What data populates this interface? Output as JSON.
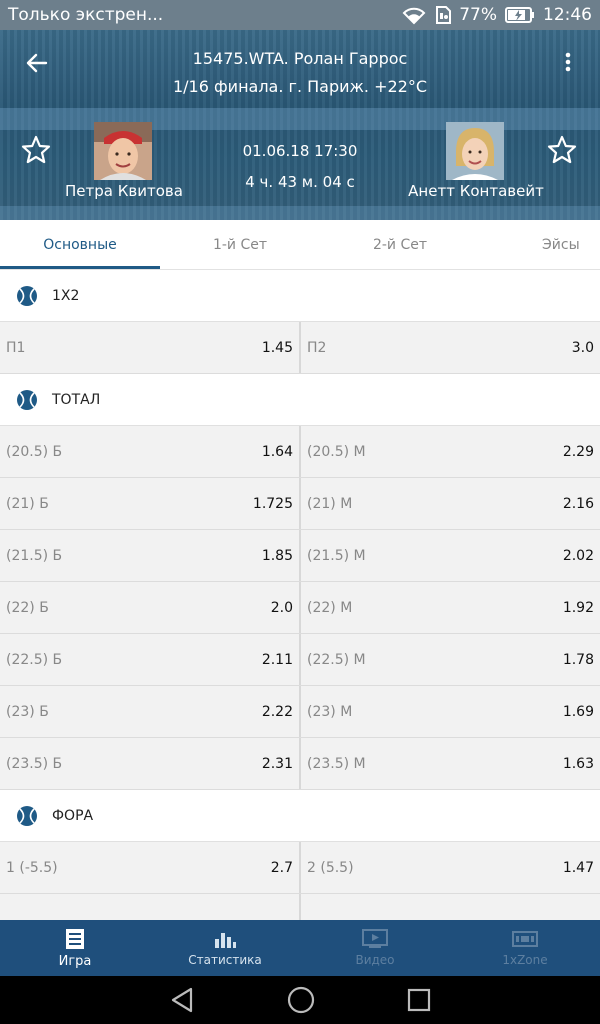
{
  "status_bar": {
    "notification": "Только экстрен...",
    "battery": "77%",
    "time": "12:46"
  },
  "header": {
    "title": "15475.WTA. Ролан Гаррос",
    "subtitle": "1/16 финала. г. Париж. +22°C",
    "date": "01.06.18 17:30",
    "duration": "4 ч. 43 м. 04 с",
    "player1": "Петра Квитова",
    "player2": "Анетт Контавейт"
  },
  "tabs": [
    {
      "label": "Основные",
      "active": true
    },
    {
      "label": "1-й Сет"
    },
    {
      "label": "2-й Сет"
    },
    {
      "label": "Эйсы"
    }
  ],
  "sections": [
    {
      "title": "1X2",
      "rows": [
        {
          "l_label": "П1",
          "l_val": "1.45",
          "r_label": "П2",
          "r_val": "3.0"
        }
      ]
    },
    {
      "title": "ТОТАЛ",
      "rows": [
        {
          "l_label": "(20.5) Б",
          "l_val": "1.64",
          "r_label": "(20.5) М",
          "r_val": "2.29"
        },
        {
          "l_label": "(21) Б",
          "l_val": "1.725",
          "r_label": "(21) М",
          "r_val": "2.16"
        },
        {
          "l_label": "(21.5) Б",
          "l_val": "1.85",
          "r_label": "(21.5) М",
          "r_val": "2.02"
        },
        {
          "l_label": "(22) Б",
          "l_val": "2.0",
          "r_label": "(22) М",
          "r_val": "1.92"
        },
        {
          "l_label": "(22.5) Б",
          "l_val": "2.11",
          "r_label": "(22.5) М",
          "r_val": "1.78"
        },
        {
          "l_label": "(23) Б",
          "l_val": "2.22",
          "r_label": "(23) М",
          "r_val": "1.69"
        },
        {
          "l_label": "(23.5) Б",
          "l_val": "2.31",
          "r_label": "(23.5) М",
          "r_val": "1.63"
        }
      ]
    },
    {
      "title": "ФОРА",
      "rows": [
        {
          "l_label": "1 (-5.5)",
          "l_val": "2.7",
          "r_label": "2 (5.5)",
          "r_val": "1.47"
        },
        {
          "l_label": "",
          "l_val": "",
          "r_label": "",
          "r_val": ""
        }
      ]
    }
  ],
  "bottom_nav": [
    {
      "label": "Игра",
      "icon": "game-icon"
    },
    {
      "label": "Статистика",
      "icon": "stats-icon"
    },
    {
      "label": "Видео",
      "icon": "video-icon"
    },
    {
      "label": "1xZone",
      "icon": "zone-icon"
    }
  ],
  "colors": {
    "accent": "#1f5a86",
    "nav_bg": "#1f4f7c",
    "status_bg": "#6d7f8c"
  }
}
